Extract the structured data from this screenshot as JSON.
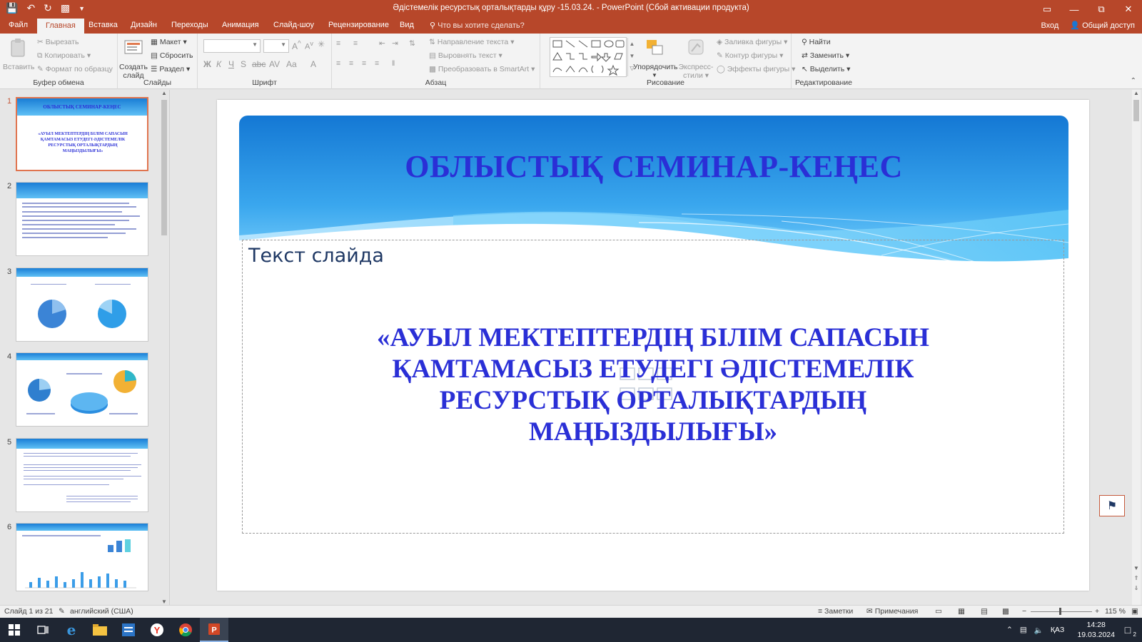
{
  "window": {
    "title": "Әдістемелік ресурстық орталықтарды құру -15.03.24. - PowerPoint (Сбой активации продукта)"
  },
  "tabs": [
    {
      "label": "Файл"
    },
    {
      "label": "Главная"
    },
    {
      "label": "Вставка"
    },
    {
      "label": "Дизайн"
    },
    {
      "label": "Переходы"
    },
    {
      "label": "Анимация"
    },
    {
      "label": "Слайд-шоу"
    },
    {
      "label": "Рецензирование"
    },
    {
      "label": "Вид"
    }
  ],
  "tellme": "Что вы хотите сделать?",
  "signin": "Вход",
  "share": "Общий доступ",
  "ribbon": {
    "clipboard": {
      "label": "Буфер обмена",
      "paste": "Вставить",
      "cut": "Вырезать",
      "copy": "Копировать",
      "format_painter": "Формат по образцу"
    },
    "slides": {
      "label": "Слайды",
      "new_slide_1": "Создать",
      "new_slide_2": "слайд",
      "layout": "Макет",
      "reset": "Сбросить",
      "section": "Раздел"
    },
    "font": {
      "label": "Шрифт",
      "font_name": "",
      "font_size": ""
    },
    "paragraph": {
      "label": "Абзац",
      "text_direction": "Направление текста",
      "align_text": "Выровнять текст",
      "smartart": "Преобразовать в SmartArt"
    },
    "drawing": {
      "label": "Рисование",
      "arrange": "Упорядочить",
      "quick_styles_1": "Экспресс-",
      "quick_styles_2": "стили",
      "shape_fill": "Заливка фигуры",
      "shape_outline": "Контур фигуры",
      "shape_effects": "Эффекты фигуры"
    },
    "editing": {
      "label": "Редактирование",
      "find": "Найти",
      "replace": "Заменить",
      "select": "Выделить"
    }
  },
  "thumbnails": [
    {
      "num": "1",
      "selected": true,
      "title": "ОБЛЫСТЫҚ СЕМИНАР-КЕҢЕС",
      "body": "«АУЫЛ МЕКТЕПТЕРДІҢ БІЛІМ САПАСЫН ҚАМТАМАСЫЗ ЕТУДЕГІ ӘДІСТЕМЕЛІК РЕСУРСТЫҚ ОРТАЛЫҚТАРДЫҢ МАҢЫЗДЫЛЫҒЫ»"
    },
    {
      "num": "2",
      "selected": false
    },
    {
      "num": "3",
      "selected": false
    },
    {
      "num": "4",
      "selected": false
    },
    {
      "num": "5",
      "selected": false
    },
    {
      "num": "6",
      "selected": false
    }
  ],
  "slide": {
    "title": "ОБЛЫСТЫҚ СЕМИНАР-КЕҢЕС",
    "placeholder": "Текст слайда",
    "body_lines": [
      "«АУЫЛ МЕКТЕПТЕРДІҢ БІЛІМ САПАСЫН",
      "ҚАМТАМАСЫЗ ЕТУДЕГІ   ӘДІСТЕМЕЛІК",
      "РЕСУРСТЫҚ ОРТАЛЫҚТАРДЫҢ",
      "МАҢЫЗДЫЛЫҒЫ»"
    ]
  },
  "status": {
    "slide_info": "Слайд 1 из 21",
    "language": "английский (США)",
    "notes": "Заметки",
    "comments": "Примечания",
    "zoom": "115 %"
  },
  "taskbar": {
    "lang": "ҚАЗ",
    "time": "14:28",
    "date": "19.03.2024",
    "notifications": "2"
  },
  "colors": {
    "accent": "#b7472a",
    "slide_title": "#2a2fd6",
    "band_top": "#1a7ed6",
    "band_bottom": "#7fd3fb"
  }
}
